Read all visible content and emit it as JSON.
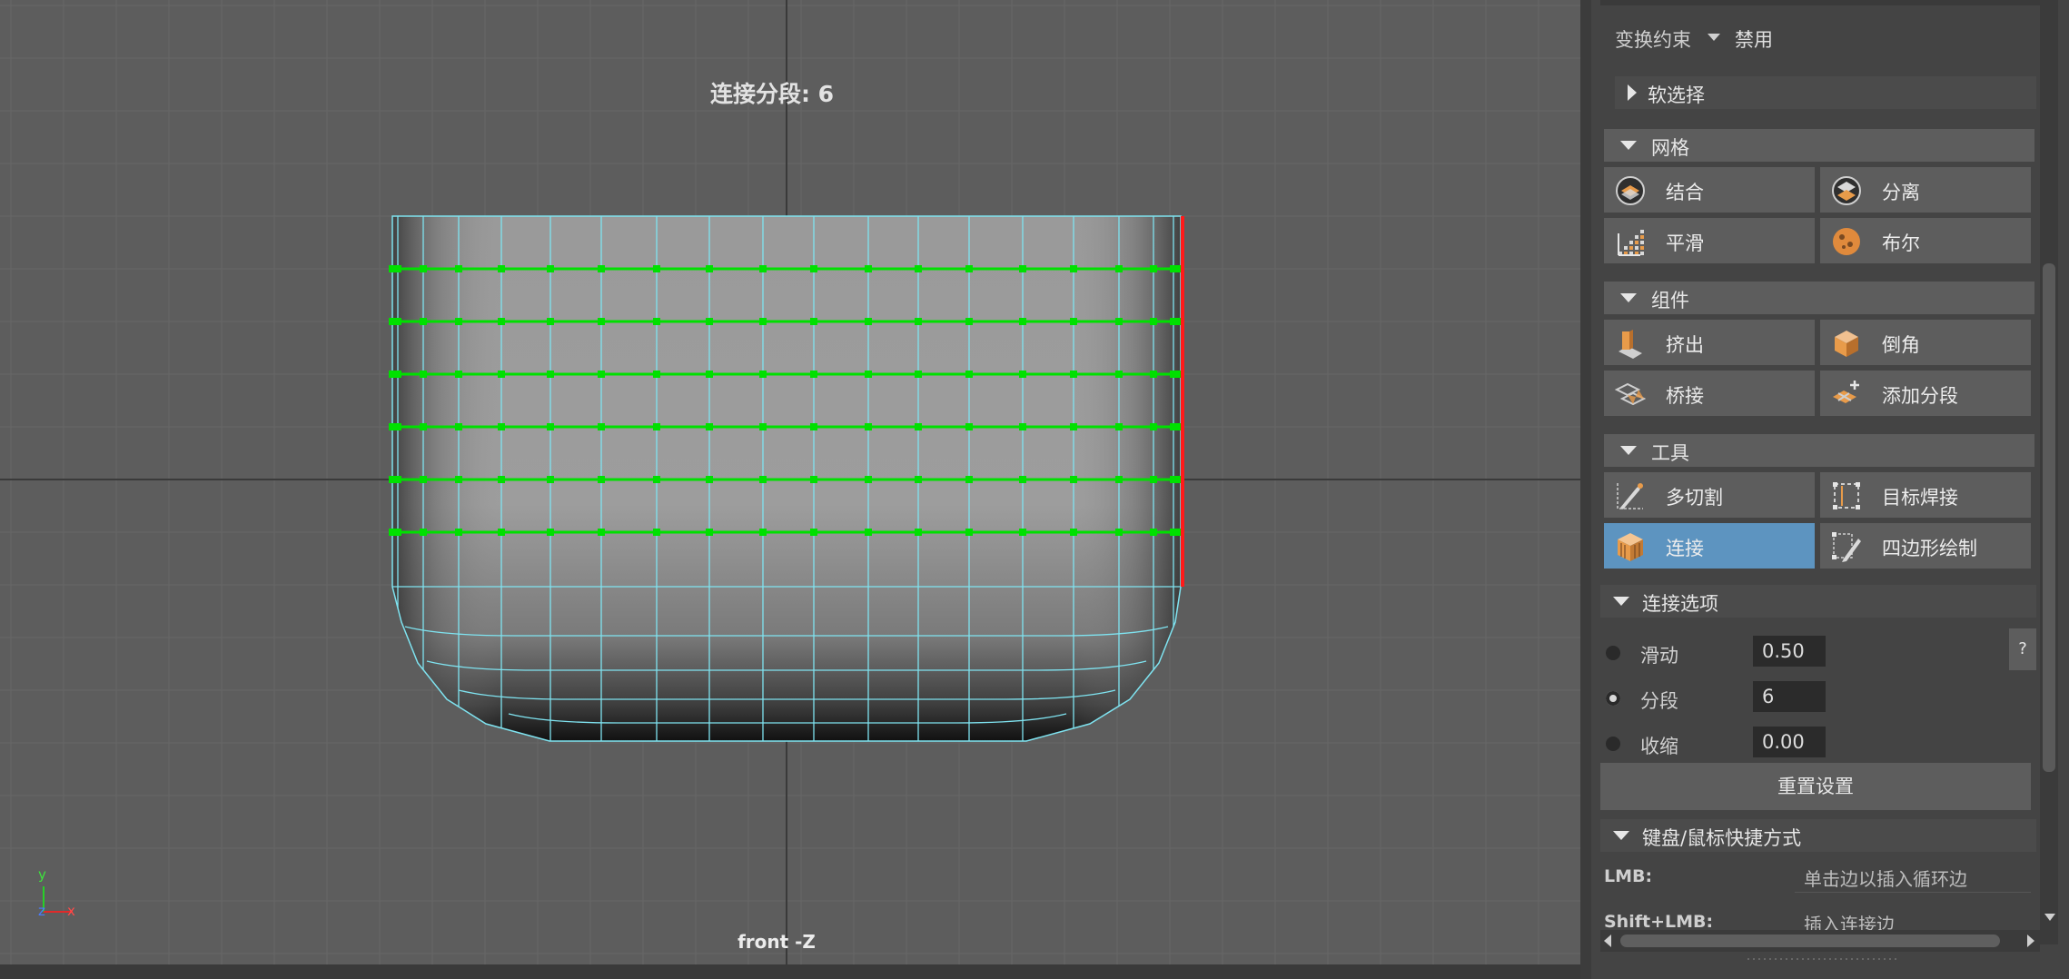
{
  "viewport": {
    "hud_title": "连接分段: 6",
    "camera_label": "front -Z",
    "axis": {
      "y": "y",
      "z": "z",
      "x": "x"
    }
  },
  "panel": {
    "transform_constraint": {
      "label": "变换约束",
      "value": "禁用"
    },
    "soft_select": "软选择",
    "sections": {
      "mesh": "网格",
      "components": "组件",
      "tools": "工具",
      "connect_options": "连接选项",
      "shortcuts": "键盘/鼠标快捷方式"
    },
    "mesh_buttons": [
      "结合",
      "分离",
      "平滑",
      "布尔"
    ],
    "component_buttons": [
      "挤出",
      "倒角",
      "桥接",
      "添加分段"
    ],
    "tool_buttons": [
      "多切割",
      "目标焊接",
      "连接",
      "四边形绘制"
    ],
    "connect_options": {
      "slide": {
        "label": "滑动",
        "value": "0.50"
      },
      "segments": {
        "label": "分段",
        "value": "6"
      },
      "pinch": {
        "label": "收缩",
        "value": "0.00"
      },
      "help": "?",
      "reset": "重置设置"
    },
    "shortcuts": [
      {
        "key": "LMB:",
        "action": "单击边以插入循环边"
      },
      {
        "key": "Shift+LMB:",
        "action": "插入连接边"
      }
    ]
  },
  "colors": {
    "active_button": "#5d94c0",
    "wire": "#7fe3f0",
    "selection": "#00e000",
    "edge_highlight": "#ff1a1a"
  }
}
